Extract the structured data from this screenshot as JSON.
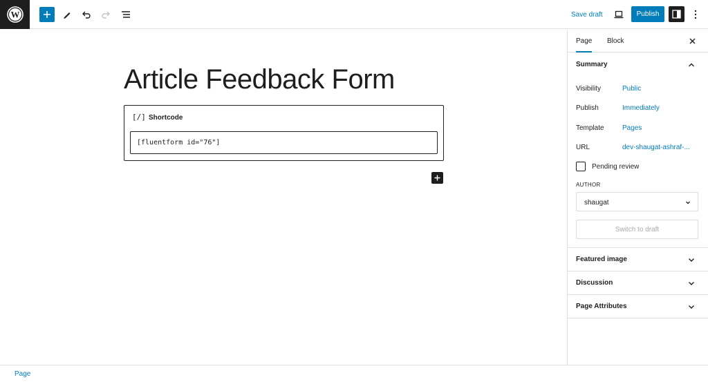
{
  "toolbar": {
    "logo_icon": "wordpress-logo-icon",
    "save_draft_label": "Save draft",
    "publish_label": "Publish",
    "accent_color": "#007cba"
  },
  "editor": {
    "title": "Article Feedback Form",
    "shortcode_block": {
      "icon_text": "[/]",
      "label": "Shortcode",
      "value": "[fluentform id=\"76\"]"
    }
  },
  "sidebar": {
    "tabs": [
      {
        "label": "Page",
        "active": true
      },
      {
        "label": "Block",
        "active": false
      }
    ],
    "summary": {
      "title": "Summary",
      "rows": [
        {
          "label": "Visibility",
          "value": "Public"
        },
        {
          "label": "Publish",
          "value": "Immediately"
        },
        {
          "label": "Template",
          "value": "Pages"
        },
        {
          "label": "URL",
          "value": "dev-shaugat-ashraf-..."
        }
      ],
      "pending_review_label": "Pending review",
      "pending_review_checked": false,
      "author_heading": "AUTHOR",
      "author_value": "shaugat",
      "switch_draft_label": "Switch to draft"
    },
    "panels": [
      {
        "title": "Featured image"
      },
      {
        "title": "Discussion"
      },
      {
        "title": "Page Attributes"
      }
    ]
  },
  "footer": {
    "breadcrumb": "Page"
  }
}
